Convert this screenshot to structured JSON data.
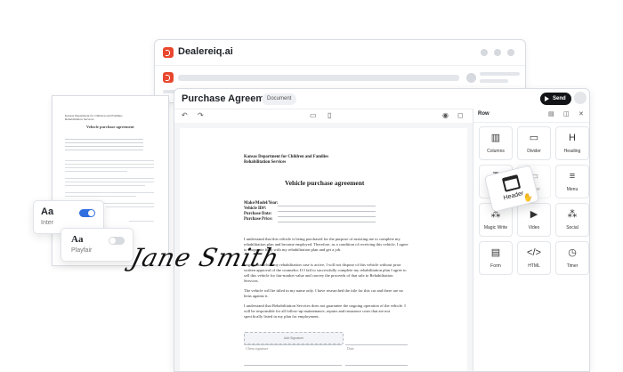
{
  "browser": {
    "title": "Dealereiq.ai"
  },
  "doc_thumb": {
    "header": "Kansas Department for Children and Families Rehabilitation Services",
    "title": "Vehicle purchase agreement"
  },
  "editor": {
    "title": "Purchase Agreement",
    "badge": "Document",
    "send_label": "Send",
    "panel_title": "Row"
  },
  "document": {
    "header_line1": "Kansas Department for Children and Families",
    "header_line2": "Rehabilitation Services",
    "title": "Vehicle purchase agreement",
    "fields": [
      "Make/Model/Year:",
      "Vehicle ID#:",
      "Purchase Date:",
      "Purchase Price:"
    ],
    "paragraphs": [
      "I understand that this vehicle is being purchased for the purpose of assisting me to complete my rehabilitation plan and become employed. Therefore, as a condition of receiving this vehicle, I agree to cooperate fully with my rehabilitation plan and get a job.",
      "I agree that while my rehabilitation case is active, I will not dispose of this vehicle without prior written approval of the counselor. If I fail to successfully complete my rehabilitation plan I agree to sell this vehicle for fair-market value and convey the proceeds of that sale to Rehabilitation Services.",
      "The vehicle will be titled in my name only. I have researched the title for this car and there are no liens against it.",
      "I understand that Rehabilitation Services does not guarantee the ongoing operation of the vehicle. I will be responsible for all follow-up maintenance, repairs and insurance costs that are not specifically listed in my plan for employment."
    ],
    "signature_box": "Add Signature",
    "sign_labels": [
      "Client signature",
      "Date"
    ]
  },
  "blocks": [
    {
      "label": "Columns",
      "icon": "columns-icon",
      "glyph": "▥"
    },
    {
      "label": "Divider",
      "icon": "divider-icon",
      "glyph": "▭"
    },
    {
      "label": "Heading",
      "icon": "heading-icon",
      "glyph": "H"
    },
    {
      "label": "",
      "icon": "text-icon",
      "glyph": "T"
    },
    {
      "label": "...ader",
      "icon": "header-icon",
      "glyph": "▭"
    },
    {
      "label": "Menu",
      "icon": "menu-icon",
      "glyph": "≡"
    },
    {
      "label": "Magic Write",
      "icon": "magic-write-icon",
      "glyph": "⁂"
    },
    {
      "label": "Video",
      "icon": "video-icon",
      "glyph": "▶"
    },
    {
      "label": "Social",
      "icon": "social-icon",
      "glyph": "⁂"
    },
    {
      "label": "Form",
      "icon": "form-icon",
      "glyph": "▤"
    },
    {
      "label": "HTML",
      "icon": "html-icon",
      "glyph": "</>"
    },
    {
      "label": "Timer",
      "icon": "timer-icon",
      "glyph": "◷"
    }
  ],
  "drag_tile": {
    "label": "Header"
  },
  "fonts_card": {
    "inter": {
      "sample": "Aa",
      "name": "Inter"
    },
    "playfair": {
      "sample": "Aa",
      "name": "Playfair"
    }
  },
  "signature": "Jane Smith"
}
